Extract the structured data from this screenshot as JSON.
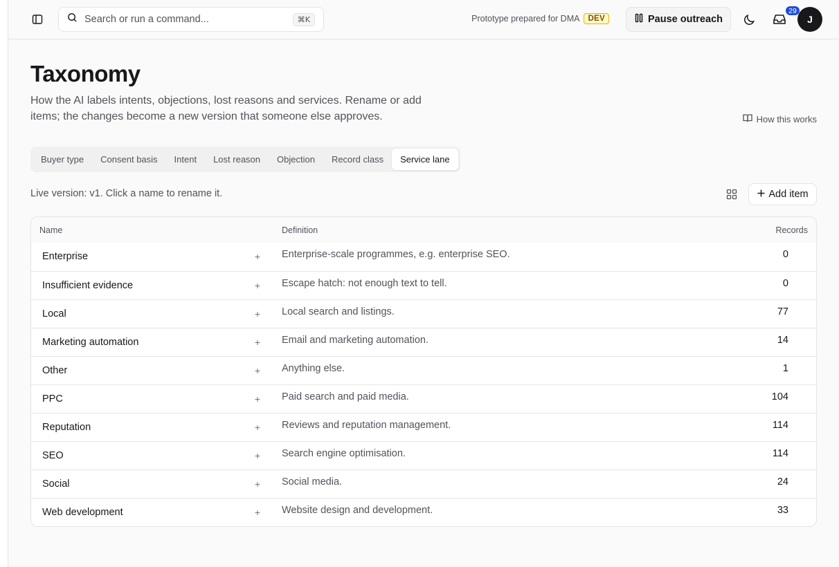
{
  "topbar": {
    "search_placeholder": "Search or run a command...",
    "search_shortcut": "⌘K",
    "prototype_text": "Prototype prepared for DMA",
    "env_badge": "DEV",
    "pause_label": "Pause outreach",
    "notification_count": "29",
    "avatar_initial": "J"
  },
  "page": {
    "title": "Taxonomy",
    "description": "How the AI labels intents, objections, lost reasons and services. Rename or add items; the changes become a new version that someone else approves.",
    "how_link": "How this works",
    "live_version": "Live version: v1. Click a name to rename it.",
    "add_item_label": "Add item"
  },
  "tabs": [
    {
      "label": "Buyer type"
    },
    {
      "label": "Consent basis"
    },
    {
      "label": "Intent"
    },
    {
      "label": "Lost reason"
    },
    {
      "label": "Objection"
    },
    {
      "label": "Record class"
    },
    {
      "label": "Service lane",
      "active": true
    }
  ],
  "table": {
    "columns": {
      "name": "Name",
      "definition": "Definition",
      "records": "Records"
    },
    "rows": [
      {
        "name": "Enterprise",
        "definition": "Enterprise-scale programmes, e.g. enterprise SEO.",
        "records": "0"
      },
      {
        "name": "Insufficient evidence",
        "definition": "Escape hatch: not enough text to tell.",
        "records": "0"
      },
      {
        "name": "Local",
        "definition": "Local search and listings.",
        "records": "77"
      },
      {
        "name": "Marketing automation",
        "definition": "Email and marketing automation.",
        "records": "14"
      },
      {
        "name": "Other",
        "definition": "Anything else.",
        "records": "1"
      },
      {
        "name": "PPC",
        "definition": "Paid search and paid media.",
        "records": "104"
      },
      {
        "name": "Reputation",
        "definition": "Reviews and reputation management.",
        "records": "114"
      },
      {
        "name": "SEO",
        "definition": "Search engine optimisation.",
        "records": "114"
      },
      {
        "name": "Social",
        "definition": "Social media.",
        "records": "24"
      },
      {
        "name": "Web development",
        "definition": "Website design and development.",
        "records": "33"
      }
    ]
  },
  "icons": {
    "sidebar_toggle": "sidebar-icon",
    "search": "search-icon",
    "pause": "pause-icon",
    "theme": "moon-icon",
    "inbox": "inbox-icon",
    "book": "book-icon",
    "grid": "grid-icon",
    "plus": "plus-icon"
  },
  "colors": {
    "badge_blue": "#1d4ed8",
    "dev_badge_bg": "#fef9c3",
    "dev_badge_border": "#eab308"
  }
}
